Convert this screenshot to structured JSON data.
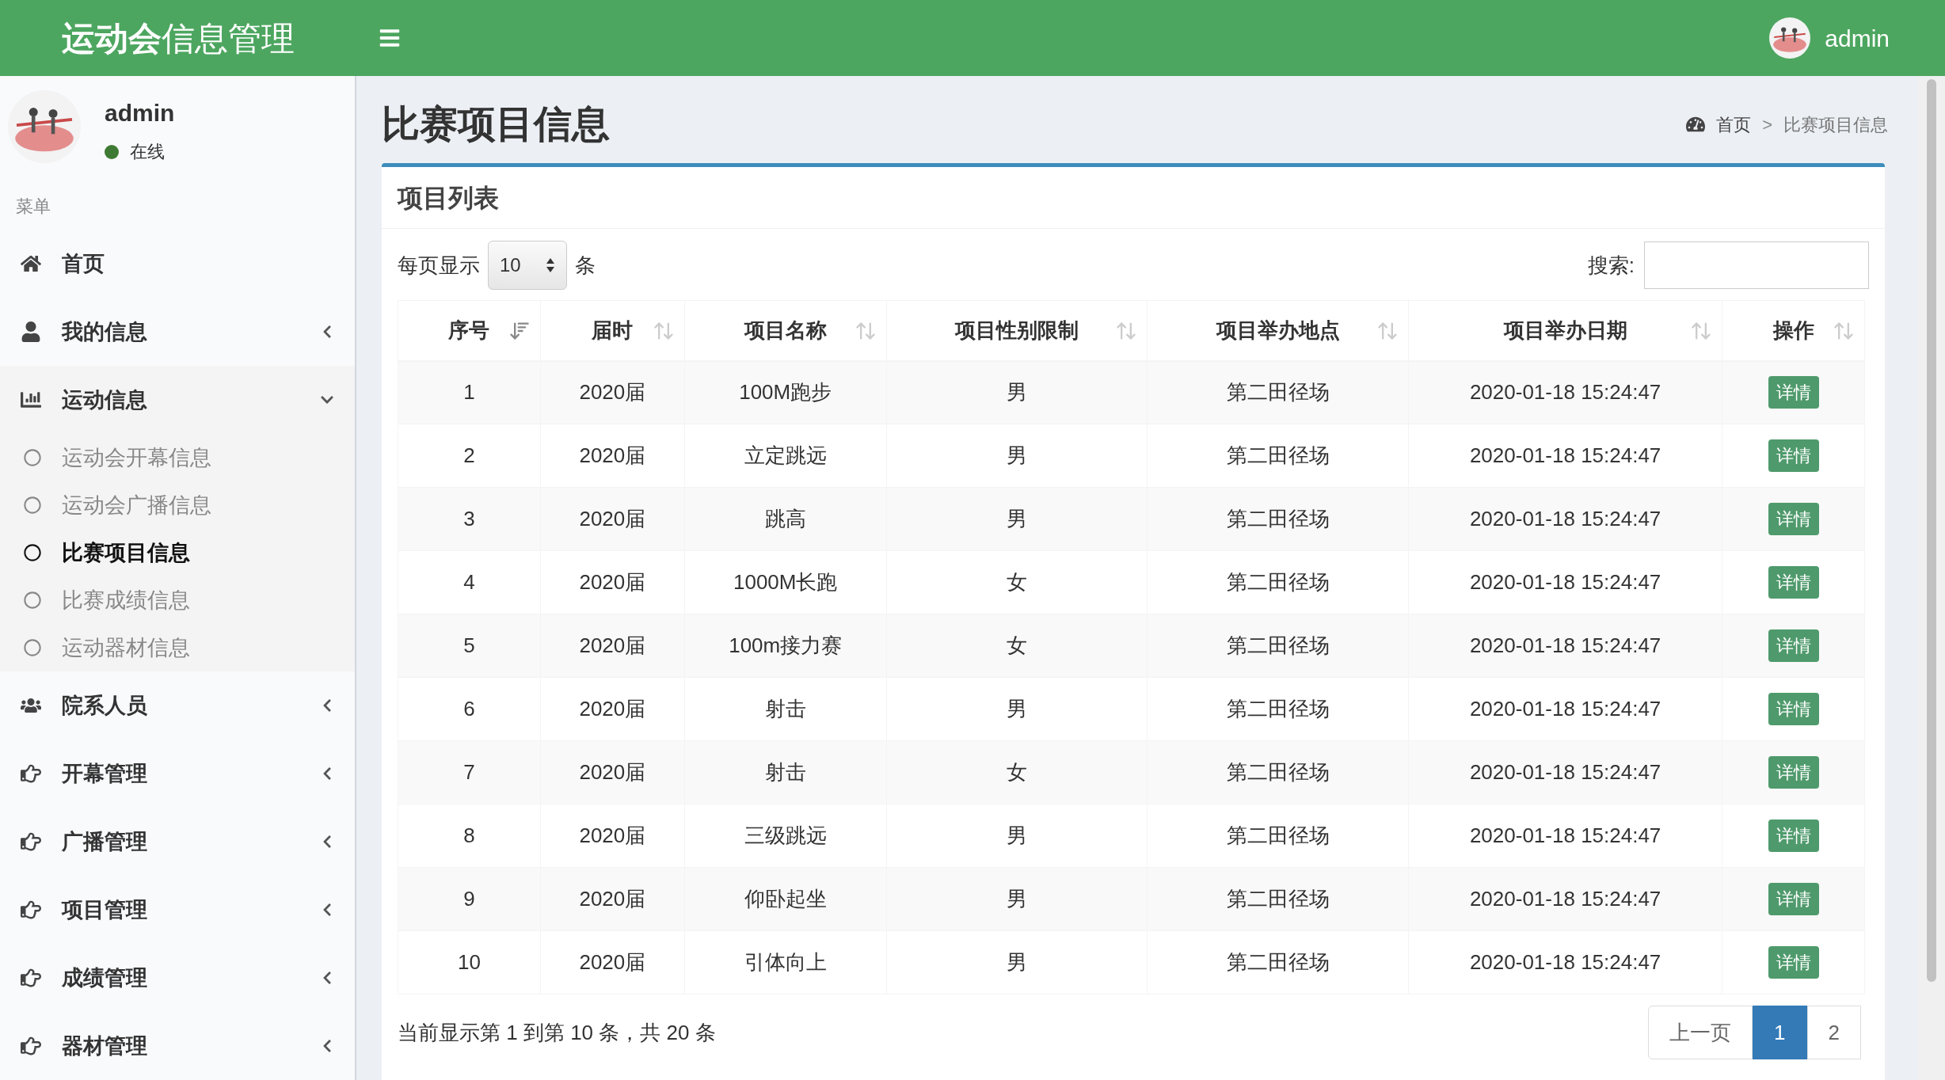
{
  "header": {
    "logo": "**运动会**信息管理",
    "user": "admin"
  },
  "sidebar": {
    "user": {
      "name": "admin",
      "status": "在线"
    },
    "menu_label": "菜单",
    "items": [
      {
        "label": "首页",
        "kind": "link"
      },
      {
        "label": "我的信息",
        "kind": "group",
        "expanded": false
      },
      {
        "label": "运动信息",
        "kind": "group",
        "expanded": true,
        "children": [
          {
            "label": "运动会开幕信息",
            "selected": false
          },
          {
            "label": "运动会广播信息",
            "selected": false
          },
          {
            "label": "比赛项目信息",
            "selected": true
          },
          {
            "label": "比赛成绩信息",
            "selected": false
          },
          {
            "label": "运动器材信息",
            "selected": false
          }
        ]
      },
      {
        "label": "院系人员",
        "kind": "group",
        "expanded": false
      },
      {
        "label": "开幕管理",
        "kind": "group",
        "expanded": false
      },
      {
        "label": "广播管理",
        "kind": "group",
        "expanded": false
      },
      {
        "label": "项目管理",
        "kind": "group",
        "expanded": false
      },
      {
        "label": "成绩管理",
        "kind": "group",
        "expanded": false
      },
      {
        "label": "器材管理",
        "kind": "group",
        "expanded": false
      }
    ]
  },
  "page": {
    "title": "比赛项目信息",
    "breadcrumb": [
      "首页",
      "比赛项目信息"
    ],
    "breadcrumb_separator": ">"
  },
  "box": {
    "title": "项目列表",
    "length_label_before": "每页显示",
    "length_value": "10",
    "length_label_after": "条",
    "search_label": "搜索:",
    "table": {
      "columns": [
        {
          "label": "序号",
          "sorted": true
        },
        {
          "label": "届时",
          "sorted": false
        },
        {
          "label": "项目名称",
          "sorted": false
        },
        {
          "label": "项目性别限制",
          "sorted": false
        },
        {
          "label": "项目举办地点",
          "sorted": false
        },
        {
          "label": "项目举办日期",
          "sorted": false
        },
        {
          "label": "操作",
          "sorted": false
        }
      ],
      "rows": [
        [
          "1",
          "2020届",
          "100M跑步",
          "男",
          "第二田径场",
          "2020-01-18 15:24:47",
          "详情"
        ],
        [
          "2",
          "2020届",
          "立定跳远",
          "男",
          "第二田径场",
          "2020-01-18 15:24:47",
          "详情"
        ],
        [
          "3",
          "2020届",
          "跳高",
          "男",
          "第二田径场",
          "2020-01-18 15:24:47",
          "详情"
        ],
        [
          "4",
          "2020届",
          "1000M长跑",
          "女",
          "第二田径场",
          "2020-01-18 15:24:47",
          "详情"
        ],
        [
          "5",
          "2020届",
          "100m接力赛",
          "女",
          "第二田径场",
          "2020-01-18 15:24:47",
          "详情"
        ],
        [
          "6",
          "2020届",
          "射击",
          "男",
          "第二田径场",
          "2020-01-18 15:24:47",
          "详情"
        ],
        [
          "7",
          "2020届",
          "射击",
          "女",
          "第二田径场",
          "2020-01-18 15:24:47",
          "详情"
        ],
        [
          "8",
          "2020届",
          "三级跳远",
          "男",
          "第二田径场",
          "2020-01-18 15:24:47",
          "详情"
        ],
        [
          "9",
          "2020届",
          "仰卧起坐",
          "男",
          "第二田径场",
          "2020-01-18 15:24:47",
          "详情"
        ],
        [
          "10",
          "2020届",
          "引体向上",
          "男",
          "第二田径场",
          "2020-01-18 15:24:47",
          "详情"
        ]
      ]
    },
    "info": "当前显示第 1 到第 10 条，共 20 条",
    "pagination": [
      {
        "label": "上一页",
        "selected": false
      },
      {
        "label": "1",
        "selected": true
      },
      {
        "label": "2",
        "selected": false
      }
    ]
  }
}
